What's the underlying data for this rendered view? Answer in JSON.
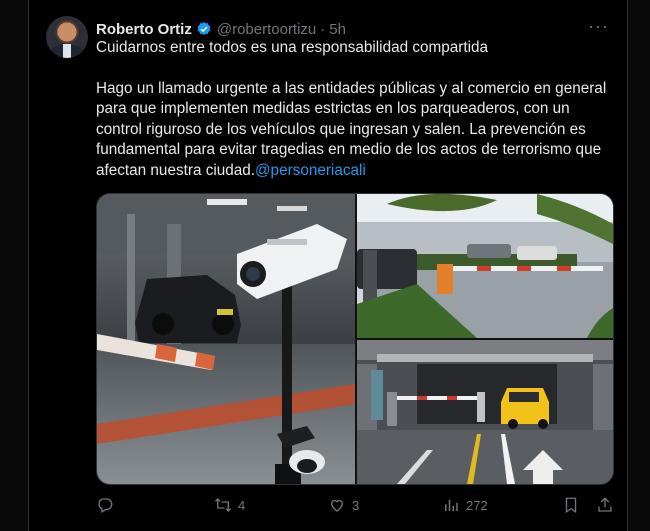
{
  "post": {
    "author_name": "Roberto Ortiz",
    "handle": "@robertoortizu",
    "time": "5h",
    "more_label": "···",
    "headline": "Cuidarnos entre todos es una responsabilidad compartida",
    "body": "Hago un llamado urgente a las entidades públicas y al comercio en general para que implementen medidas estrictas en los parqueaderos, con un control riguroso de los vehículos que ingresan y salen. La prevención es fundamental para evitar tragedias en medio de los actos de terrorismo que afectan nuestra ciudad.",
    "mention": "@personeriacali"
  },
  "media": {
    "image_1": "security-camera-parking",
    "image_2": "parking-barrier-entrance",
    "image_3": "parking-garage-taxi"
  },
  "actions": {
    "reply": "",
    "repost": "4",
    "like": "3",
    "views": "272",
    "bookmark": "",
    "share": ""
  },
  "icons": [
    "verified-icon",
    "more-icon",
    "reply-icon",
    "repost-icon",
    "like-icon",
    "views-icon",
    "bookmark-icon",
    "share-icon"
  ],
  "colors": {
    "accent": "#1d9bf0",
    "muted": "#71767b",
    "text": "#e7e9ea",
    "background": "#000000"
  }
}
